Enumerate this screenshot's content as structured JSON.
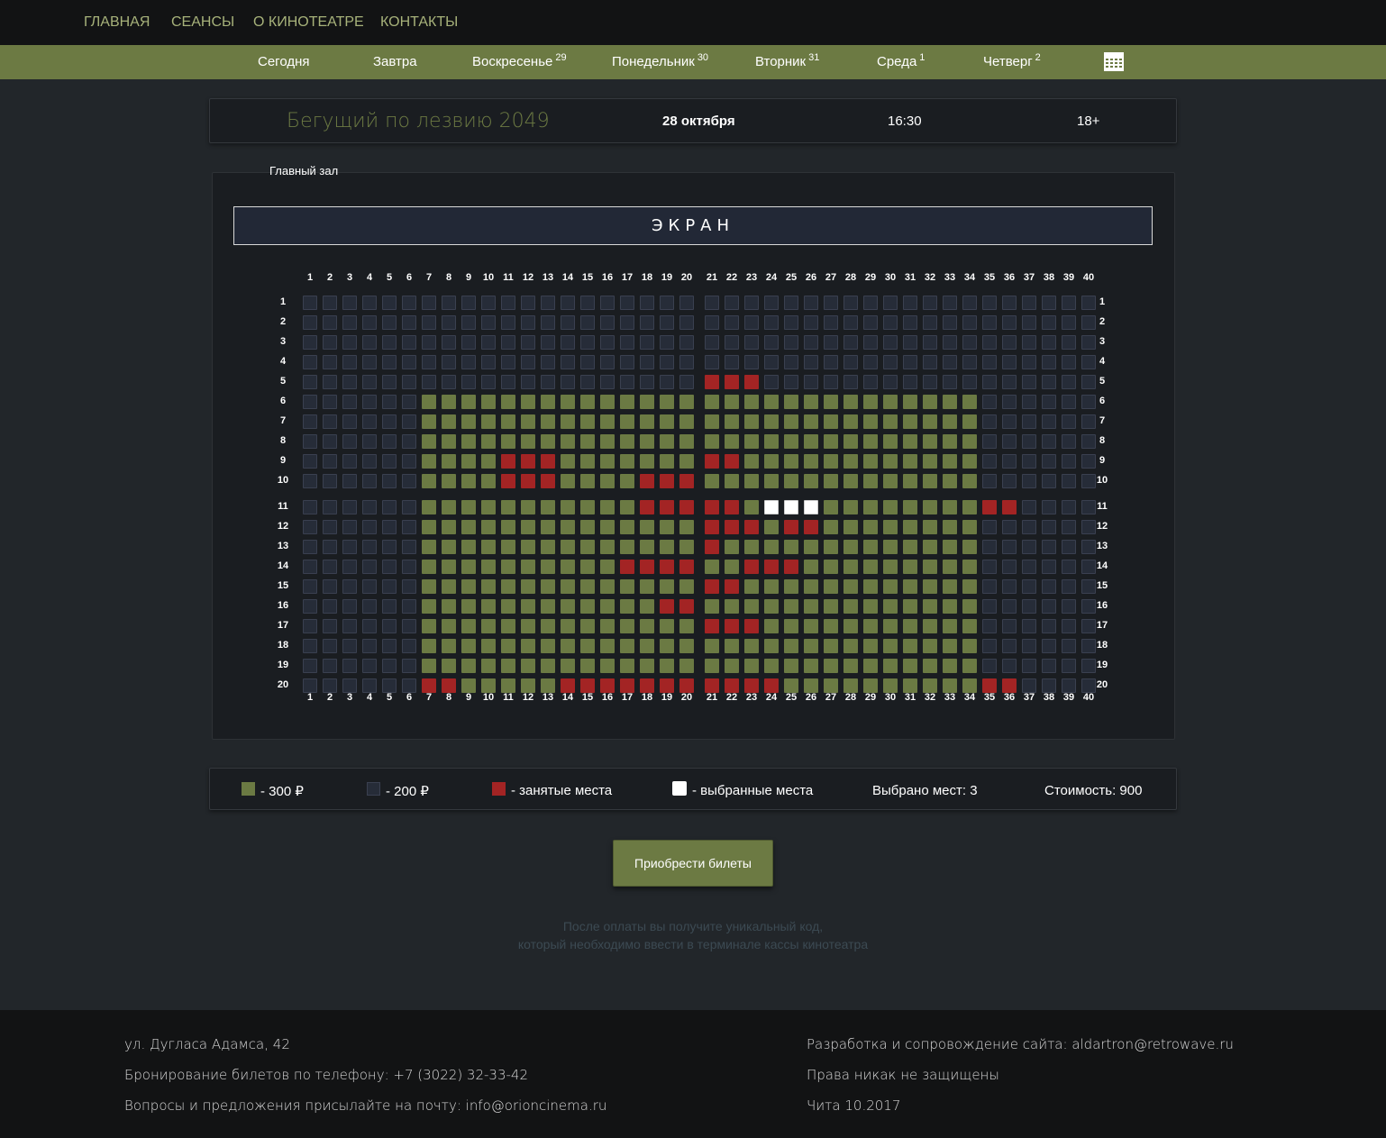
{
  "nav": {
    "items": [
      "ГЛАВНАЯ",
      "СЕАНСЫ",
      "О КИНОТЕАТРЕ",
      "КОНТАКТЫ"
    ]
  },
  "days": [
    {
      "label": "Сегодня",
      "num": ""
    },
    {
      "label": "Завтра",
      "num": ""
    },
    {
      "label": "Воскресенье",
      "num": "29"
    },
    {
      "label": "Понедельник",
      "num": "30"
    },
    {
      "label": "Вторник",
      "num": "31"
    },
    {
      "label": "Среда",
      "num": "1"
    },
    {
      "label": "Четверг",
      "num": "2"
    }
  ],
  "calendar_icon": "calendar-grid-icon",
  "session": {
    "film": "Бегущий по лезвию 2049",
    "date": "28 октября",
    "time": "16:30",
    "age": "18+"
  },
  "hall": {
    "name": "Главный зал",
    "screen": "ЭКРАН",
    "rows": 20,
    "cols": 40,
    "aisle_after_col": 20,
    "aisle_after_row": 10,
    "premium": {
      "rows_from": 6,
      "rows_to": 20,
      "cols_from": 7,
      "cols_to": 34
    },
    "taken": {
      "5": [
        21,
        22,
        23
      ],
      "9": [
        11,
        12,
        13,
        21,
        22
      ],
      "10": [
        11,
        12,
        13,
        18,
        19,
        20
      ],
      "11": [
        18,
        19,
        20,
        21,
        22,
        35,
        36
      ],
      "12": [
        21,
        22,
        23,
        25,
        26
      ],
      "13": [
        21
      ],
      "14": [
        17,
        18,
        19,
        20,
        23,
        24,
        25
      ],
      "15": [
        21,
        22
      ],
      "16": [
        19,
        20
      ],
      "17": [
        21,
        22,
        23
      ],
      "20": [
        7,
        8,
        14,
        15,
        16,
        17,
        18,
        19,
        20,
        21,
        22,
        23,
        24,
        35,
        36
      ]
    },
    "selected": {
      "11": [
        24,
        25,
        26
      ]
    }
  },
  "legend": {
    "price_high": "- 300 ₽",
    "price_low": "- 200 ₽",
    "taken": "- занятые места",
    "selected": "- выбранные места",
    "count": "Выбрано мест: 3",
    "cost": "Стоимость: 900"
  },
  "colors": {
    "accent": "#6c7a43",
    "taken": "#a32424",
    "regular": "#262c38",
    "selected": "#ffffff"
  },
  "buy_button": "Приобрести билеты",
  "note": {
    "line1": "После оплаты вы получите уникальный код,",
    "line2": "который необходимо ввести в терминале кассы кинотеатра"
  },
  "footer": {
    "address": "ул. Дугласа Адамса, 42",
    "phone": "Бронирование билетов по телефону: +7 (3022) 32-33-42",
    "email": "Вопросы и предложения присылайте на почту: info@orioncinema.ru",
    "dev": "Разработка и сопровождение сайта: aldartron@retrowave.ru",
    "rights": "Права никак не защищены",
    "city": "Чита 10.2017"
  }
}
